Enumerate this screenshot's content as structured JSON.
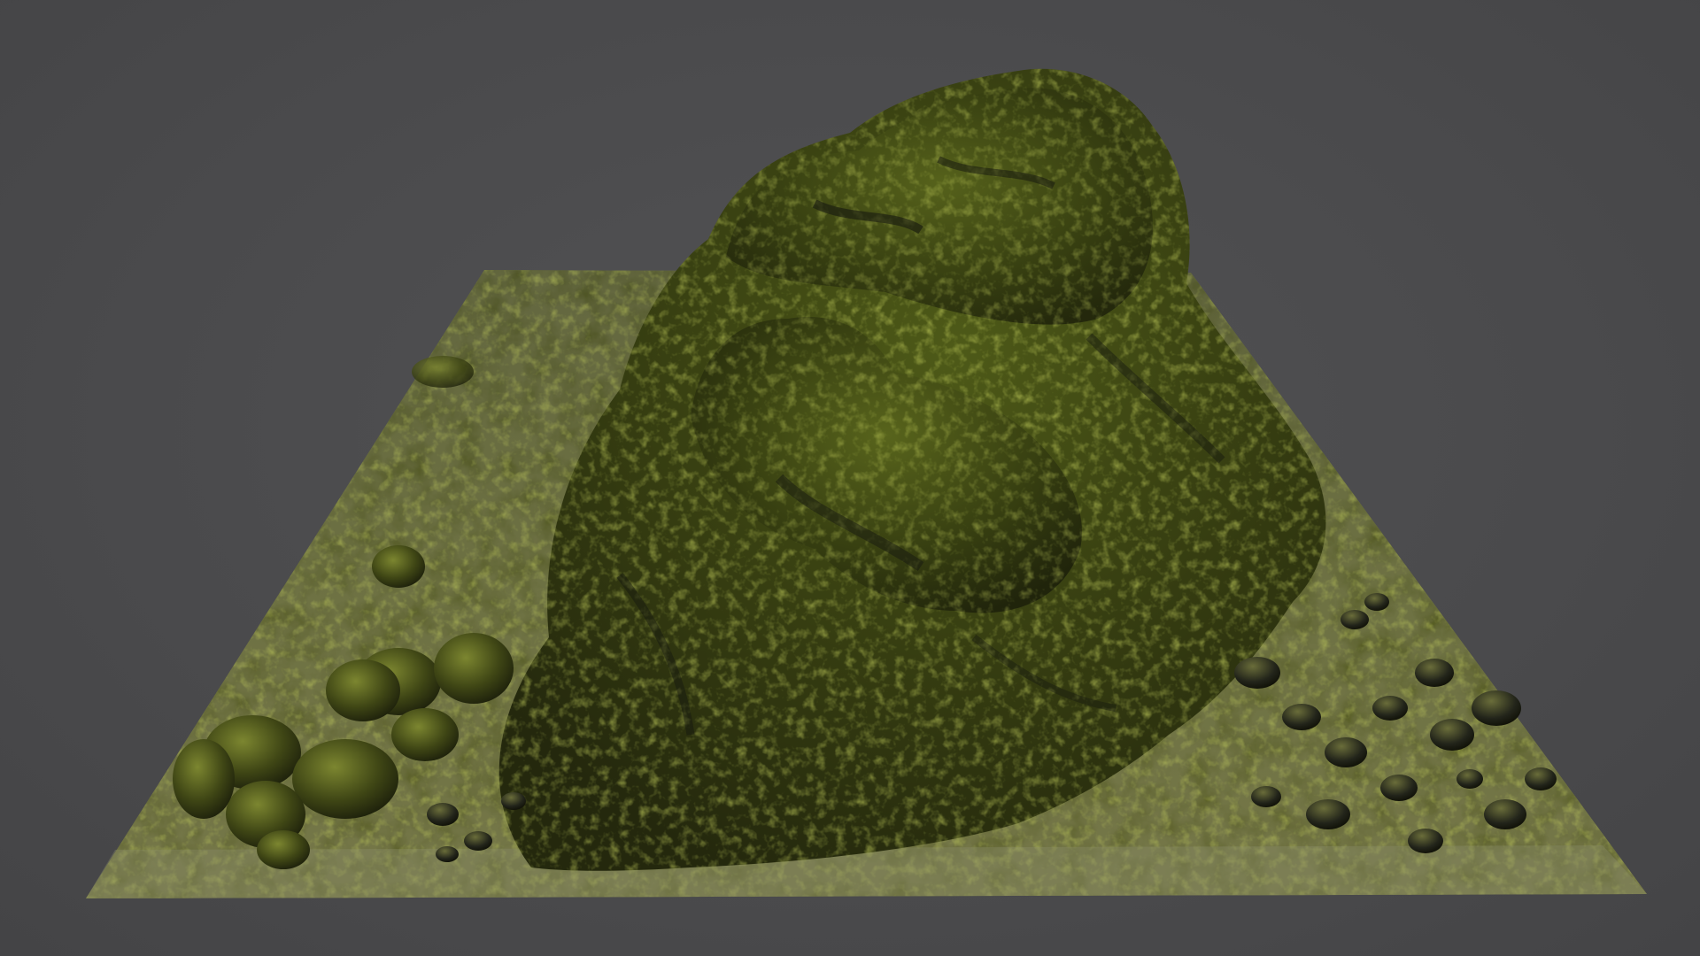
{
  "viewport": {
    "background_color": "#4b4b4d"
  },
  "scene": {
    "subject_icon": "mossy-rock-mound-icon",
    "palette": {
      "moss_light": "#9aa52a",
      "moss_mid": "#6f7a1e",
      "moss_dark": "#3d4314",
      "rock_gray": "#6d6c66",
      "rock_dark": "#23251c",
      "shadow": "#15170f"
    }
  }
}
